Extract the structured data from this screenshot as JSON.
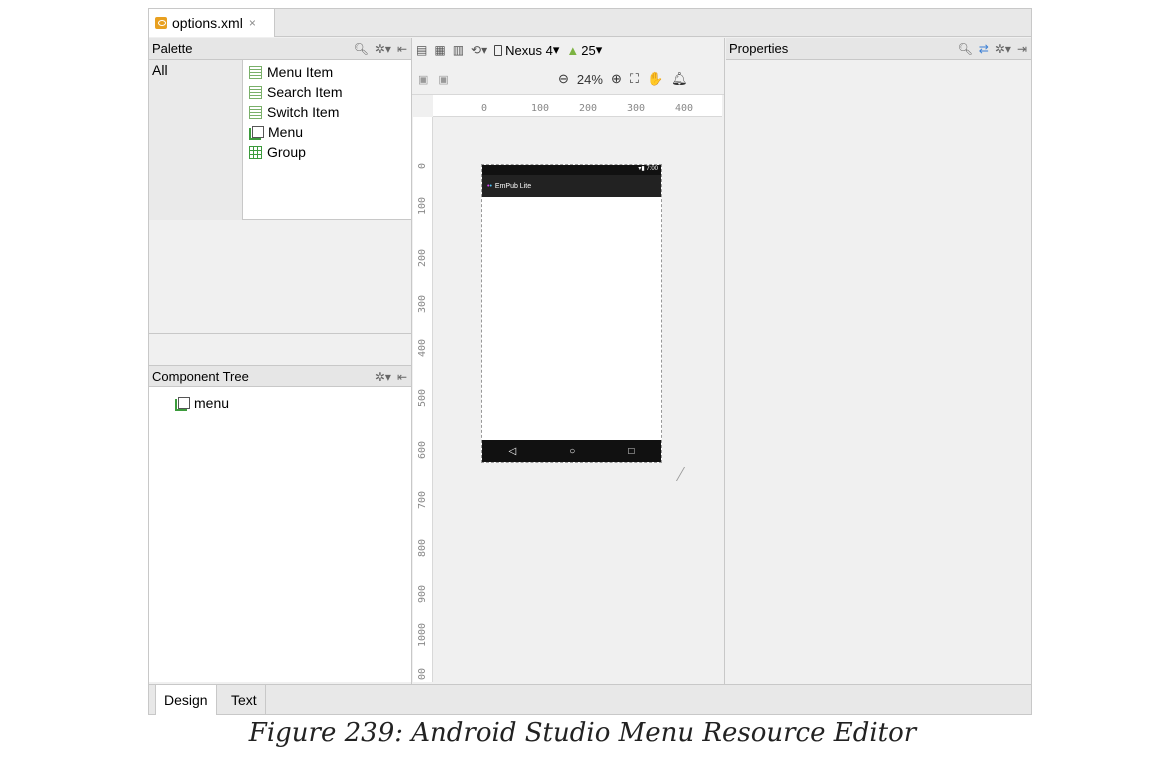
{
  "file_tab": {
    "label": "options.xml",
    "close": "×"
  },
  "palette": {
    "title": "Palette",
    "category": "All",
    "items": [
      {
        "label": "Menu Item"
      },
      {
        "label": "Search Item"
      },
      {
        "label": "Switch Item"
      },
      {
        "label": "Menu"
      },
      {
        "label": "Group"
      }
    ]
  },
  "toolbar": {
    "device": "Nexus 4",
    "api": "25",
    "zoom": "24%"
  },
  "ruler": {
    "top": [
      "0",
      "100",
      "200",
      "300",
      "400"
    ],
    "left": [
      "0",
      "100",
      "200",
      "300",
      "400",
      "500",
      "600",
      "700",
      "800",
      "900",
      "1000",
      "00"
    ]
  },
  "device_preview": {
    "time": "7:00",
    "app_title": "EmPub Lite",
    "nav": [
      "◁",
      "○",
      "□"
    ]
  },
  "component_tree": {
    "title": "Component Tree",
    "items": [
      {
        "label": "menu"
      }
    ]
  },
  "properties": {
    "title": "Properties"
  },
  "bottom_tabs": {
    "design": "Design",
    "text": "Text"
  },
  "caption": "Figure 239: Android Studio Menu Resource Editor"
}
